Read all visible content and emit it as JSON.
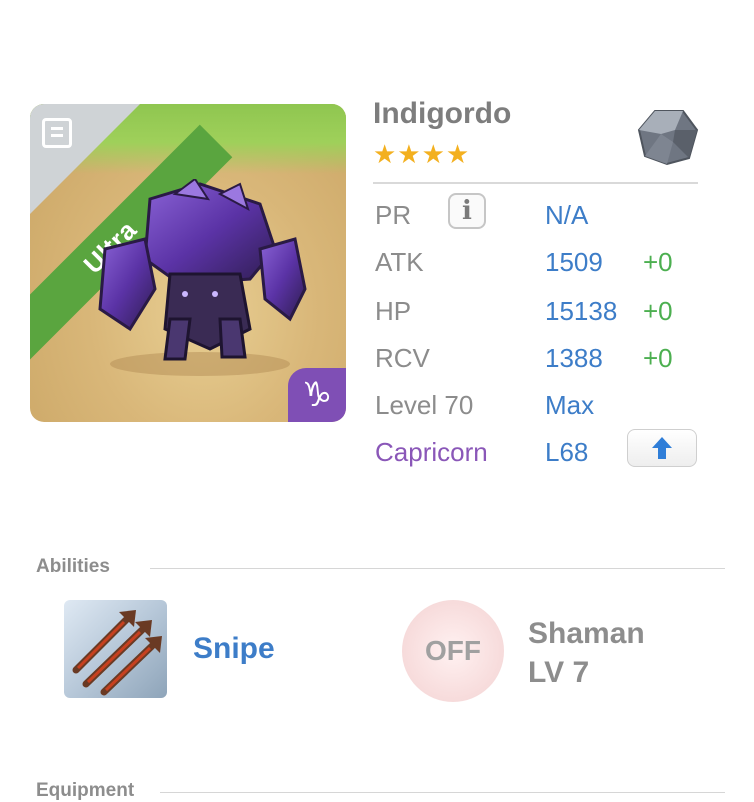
{
  "monster": {
    "name": "Indigordo",
    "stars": "★★★★",
    "rarity": "Ultra",
    "zodiac_glyph": "♑",
    "element_icon": "stone-element-icon"
  },
  "stats": {
    "pr": {
      "label": "PR",
      "value": "N/A"
    },
    "atk": {
      "label": "ATK",
      "value": "1509",
      "bonus": "+0"
    },
    "hp": {
      "label": "HP",
      "value": "15138",
      "bonus": "+0"
    },
    "rcv": {
      "label": "RCV",
      "value": "1388",
      "bonus": "+0"
    },
    "level": {
      "label": "Level 70",
      "value": "Max"
    },
    "sign": {
      "label": "Capricorn",
      "value": "L68"
    }
  },
  "colors": {
    "sign_label": "#8a57b8",
    "value": "#3d7dc8",
    "bonus": "#4caf50",
    "rarity_ribbon": "#5aa53f",
    "stars": "#f3b01f"
  },
  "abilities": {
    "title": "Abilities",
    "skill": {
      "name": "Snipe",
      "icon": "arrows-icon"
    },
    "passive": {
      "status": "OFF",
      "name": "Shaman",
      "level": "LV 7"
    }
  },
  "equipment": {
    "title": "Equipment"
  }
}
